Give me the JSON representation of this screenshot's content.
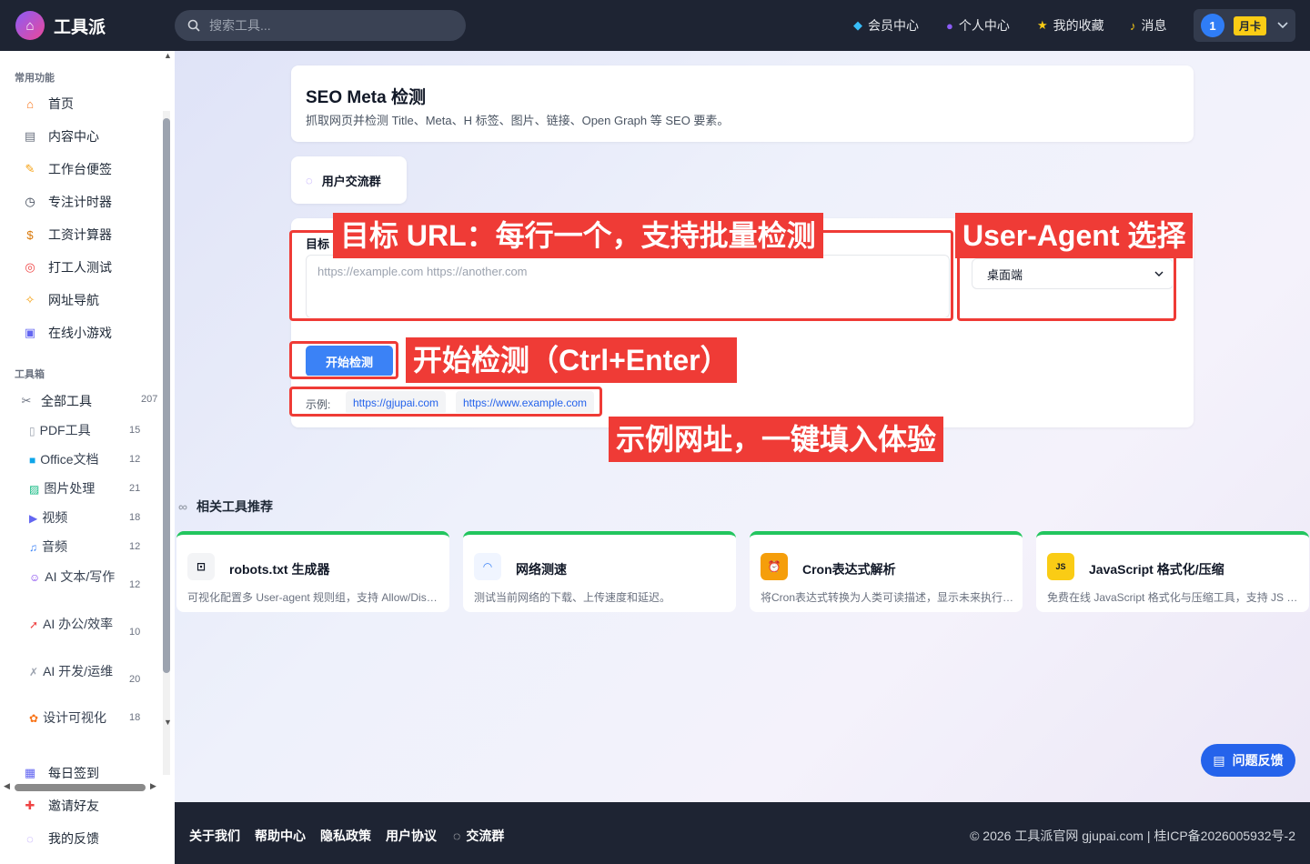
{
  "app": {
    "name": "工具派",
    "logo_glyph": "⌂"
  },
  "search": {
    "placeholder": "搜索工具..."
  },
  "nav": [
    {
      "label": "会员中心",
      "icon": "diamond-icon",
      "glyph": "◆",
      "color": "#38bdf8"
    },
    {
      "label": "个人中心",
      "icon": "user-icon",
      "glyph": "●",
      "color": "#8b5cf6"
    },
    {
      "label": "我的收藏",
      "icon": "star-icon",
      "glyph": "★",
      "color": "#facc15"
    },
    {
      "label": "消息",
      "icon": "bell-icon",
      "glyph": "♪",
      "color": "#facc15"
    }
  ],
  "user": {
    "avatar": "1",
    "plan": "月卡"
  },
  "sidebar": {
    "common_title": "常用功能",
    "common": [
      {
        "label": "首页",
        "icon": "home-icon",
        "glyph": "⌂"
      },
      {
        "label": "内容中心",
        "icon": "news-icon",
        "glyph": "▤"
      },
      {
        "label": "工作台便签",
        "icon": "note-icon",
        "glyph": "✎"
      },
      {
        "label": "专注计时器",
        "icon": "timer-icon",
        "glyph": "◷"
      },
      {
        "label": "工资计算器",
        "icon": "money-bag-icon",
        "glyph": "$"
      },
      {
        "label": "打工人测试",
        "icon": "target-icon",
        "glyph": "◎"
      },
      {
        "label": "网址导航",
        "icon": "compass-icon",
        "glyph": "✧"
      },
      {
        "label": "在线小游戏",
        "icon": "gamepad-icon",
        "glyph": "▣"
      }
    ],
    "toolbox_title": "工具箱",
    "all_tools": {
      "label": "全部工具",
      "count": "207",
      "icon": "tools-icon",
      "glyph": "✂"
    },
    "categories": [
      {
        "label": "PDF工具",
        "count": "15",
        "icon": "pdf-icon",
        "glyph": "▯"
      },
      {
        "label": "Office文档",
        "count": "12",
        "icon": "office-icon",
        "glyph": "■"
      },
      {
        "label": "图片处理",
        "count": "21",
        "icon": "image-icon",
        "glyph": "▨"
      },
      {
        "label": "视频",
        "count": "18",
        "icon": "video-icon",
        "glyph": "▶"
      },
      {
        "label": "音频",
        "count": "12",
        "icon": "music-icon",
        "glyph": "♫"
      },
      {
        "label": "AI 文本/写作",
        "count": "12",
        "icon": "robot-icon",
        "glyph": "☺"
      },
      {
        "label": "AI 办公/效率",
        "count": "10",
        "icon": "rocket-icon",
        "glyph": "➚"
      },
      {
        "label": "AI 开发/运维",
        "count": "20",
        "icon": "wrench-icon",
        "glyph": "✗"
      },
      {
        "label": "设计可视化",
        "count": "18",
        "icon": "palette-icon",
        "glyph": "✿"
      }
    ],
    "bottom": [
      {
        "label": "每日签到",
        "icon": "calendar-icon",
        "glyph": "▦"
      },
      {
        "label": "邀请好友",
        "icon": "gift-icon",
        "glyph": "✚"
      },
      {
        "label": "我的反馈",
        "icon": "chat-icon",
        "glyph": "◌"
      }
    ]
  },
  "page": {
    "title": "SEO Meta 检测",
    "subtitle": "抓取网页并检测 Title、Meta、H 标签、图片、链接、Open Graph 等 SEO 要素。"
  },
  "group_button": {
    "label": "用户交流群"
  },
  "form": {
    "url_label": "目标",
    "url_placeholder": "https://example.com https://another.com",
    "ua_value": "桌面端",
    "start_label": "开始检测",
    "examples_label": "示例:",
    "examples": [
      "https://gjupai.com",
      "https://www.example.com"
    ]
  },
  "annotations": {
    "url": "目标 URL：每行一个，支持批量检测",
    "ua": "User-Agent 选择",
    "start": "开始检测（Ctrl+Enter）",
    "examples": "示例网址，一键填入体验",
    "color": "#ef3b36"
  },
  "related": {
    "title": "相关工具推荐",
    "items": [
      {
        "name": "robots.txt 生成器",
        "desc": "可视化配置多 User-agent 规则组，支持 Allow/Disallow",
        "icon": "robot-face-icon",
        "glyph": "⊡",
        "bg": "#f3f4f6",
        "fg": "#111827"
      },
      {
        "name": "网络测速",
        "desc": "测试当前网络的下载、上传速度和延迟。",
        "icon": "speedometer-icon",
        "glyph": "◠",
        "bg": "#f0f5ff",
        "fg": "#3b82f6"
      },
      {
        "name": "Cron表达式解析",
        "desc": "将Cron表达式转换为人类可读描述，显示未来执行时间",
        "icon": "alarm-clock-icon",
        "glyph": "⏰",
        "bg": "#f59e0b",
        "fg": "#ffffff"
      },
      {
        "name": "JavaScript 格式化/压缩",
        "desc": "免费在线 JavaScript 格式化与压缩工具，支持 JS 代码美化",
        "icon": "js-icon",
        "glyph": "JS",
        "bg": "#facc15",
        "fg": "#111827"
      }
    ]
  },
  "feedback": {
    "label": "问题反馈"
  },
  "footer": {
    "links": [
      "关于我们",
      "帮助中心",
      "隐私政策",
      "用户协议",
      "交流群"
    ],
    "copyright": "© 2026 工具派官网 gjupai.com | 桂ICP备2026005932号-2"
  }
}
